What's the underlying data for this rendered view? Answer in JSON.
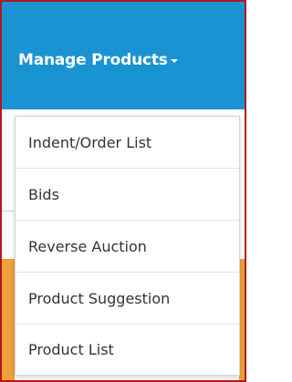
{
  "nav": {
    "title": "Manage Products",
    "caret_icon": "caret-down-icon"
  },
  "menu": {
    "items": [
      {
        "label": "Indent/Order List"
      },
      {
        "label": "Bids"
      },
      {
        "label": "Reverse Auction"
      },
      {
        "label": "Product Suggestion"
      },
      {
        "label": "Product List"
      }
    ]
  },
  "colors": {
    "nav_background": "#1a93d2",
    "nav_text": "#ffffff",
    "accent_orange": "#f0a13a",
    "frame_border": "#b4161c",
    "menu_text": "#333333"
  }
}
